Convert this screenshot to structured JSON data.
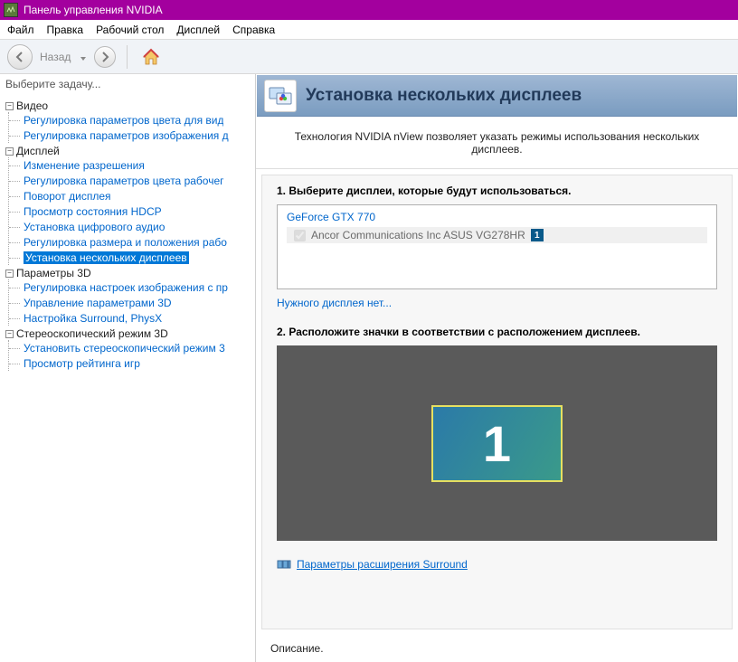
{
  "window": {
    "title": "Панель управления NVIDIA"
  },
  "menubar": [
    "Файл",
    "Правка",
    "Рабочий стол",
    "Дисплей",
    "Справка"
  ],
  "toolbar": {
    "back_label": "Назад"
  },
  "left_header": "Выберите задачу...",
  "tree": [
    {
      "label": "Видео",
      "children": [
        "Регулировка параметров цвета для вид",
        "Регулировка параметров изображения д"
      ]
    },
    {
      "label": "Дисплей",
      "children": [
        "Изменение разрешения",
        "Регулировка параметров цвета рабочег",
        "Поворот дисплея",
        "Просмотр состояния HDCP",
        "Установка цифрового аудио",
        "Регулировка размера и положения рабо",
        "Установка нескольких дисплеев"
      ],
      "selected_index": 6
    },
    {
      "label": "Параметры 3D",
      "children": [
        "Регулировка настроек изображения с пр",
        "Управление параметрами 3D",
        "Настройка Surround, PhysX"
      ]
    },
    {
      "label": "Стереоскопический режим 3D",
      "children": [
        "Установить стереоскопический режим 3",
        "Просмотр рейтинга игр"
      ]
    }
  ],
  "page": {
    "title": "Установка нескольких дисплеев",
    "description": "Технология NVIDIA nView позволяет указать режимы использования нескольких дисплеев.",
    "step1_label": "1. Выберите дисплеи, которые будут использоваться.",
    "gpu_name": "GeForce GTX 770",
    "display_item": {
      "name": "Ancor Communications Inc ASUS VG278HR",
      "badge": "1"
    },
    "missing_link": "Нужного дисплея нет...",
    "step2_label": "2. Расположите значки в соответствии с расположением дисплеев.",
    "monitor_number": "1",
    "surround_link": "Параметры расширения Surround",
    "description_label": "Описание."
  }
}
